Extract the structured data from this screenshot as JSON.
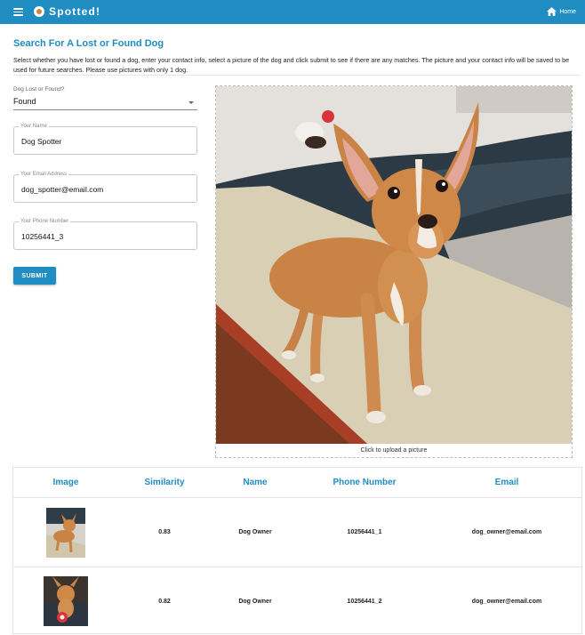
{
  "app": {
    "title": "Spotted!",
    "home_label": "Home",
    "brand_color": "#1f8dc2"
  },
  "page": {
    "title": "Search For A Lost or Found Dog",
    "instructions": "Select whether you have lost or found a dog, enter your contact info, select a picture of the dog and click submit to see if there are any matches. The picture and your contact info will be saved to be used for future searches. Please use pictures with only 1 dog."
  },
  "form": {
    "status_label": "Dog Lost or Found?",
    "status_value": "Found",
    "name_label": "Your Name",
    "name_value": "Dog Spotter",
    "email_label": "Your Email Address",
    "email_value": "dog_spotter@email.com",
    "phone_label": "Your Phone Number",
    "phone_value": "10256441_3",
    "submit_label": "SUBMIT"
  },
  "upload": {
    "caption": "Click to upload a picture"
  },
  "results": {
    "columns": [
      "Image",
      "Similarity",
      "Name",
      "Phone Number",
      "Email"
    ],
    "rows": [
      {
        "similarity": "0.83",
        "name": "Dog Owner",
        "phone": "10256441_1",
        "email": "dog_owner@email.com"
      },
      {
        "similarity": "0.82",
        "name": "Dog Owner",
        "phone": "10256441_2",
        "email": "dog_owner@email.com"
      }
    ]
  }
}
